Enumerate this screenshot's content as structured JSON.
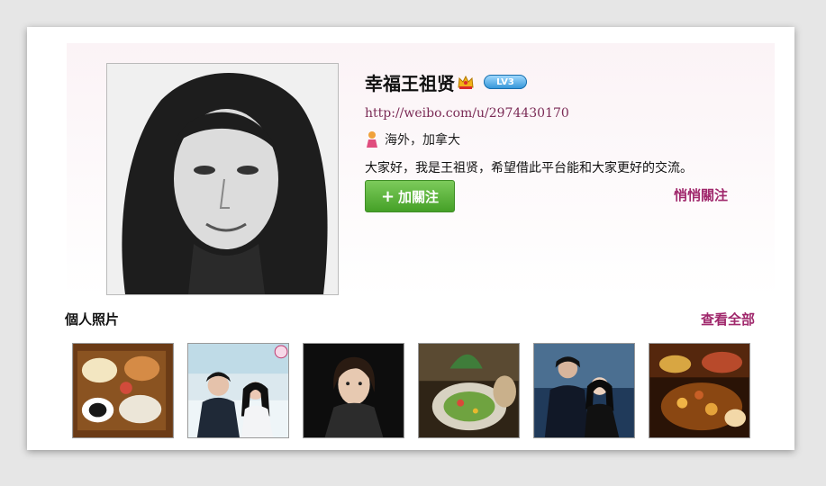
{
  "profile": {
    "name": "幸福王祖贤",
    "level_badge": "LV3",
    "url": "http://weibo.com/u/2974430170",
    "location": "海外，加拿大",
    "bio": "大家好，我是王祖贤，希望借此平台能和大家更好的交流。",
    "follow_label": "加關注",
    "quiet_follow_label": "悄悄關注",
    "icons": [
      "crown-icon",
      "location-person-icon",
      "plus-icon"
    ]
  },
  "photos": {
    "title": "個人照片",
    "view_all_label": "查看全部",
    "items": [
      {
        "subject": "food-table"
      },
      {
        "subject": "couple-snow"
      },
      {
        "subject": "woman-portrait"
      },
      {
        "subject": "salad-plate"
      },
      {
        "subject": "couple-night"
      },
      {
        "subject": "dinner-dishes"
      }
    ]
  },
  "colors": {
    "accent_link": "#a0286c",
    "url_color": "#7b2b56",
    "follow_button": "#4fa82f",
    "level_badge": "#2f93d7"
  }
}
